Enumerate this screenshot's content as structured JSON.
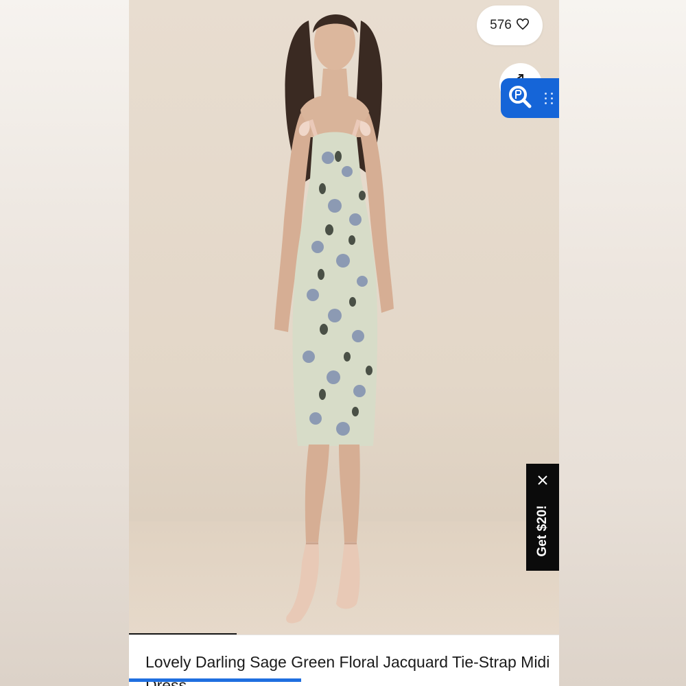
{
  "listing": {
    "likes": "576",
    "title": "Lovely Darling Sage Green Floral Jacquard Tie-Strap Midi Dress"
  },
  "promo": {
    "label": "Get $20!"
  },
  "icons": {
    "like": "heart-icon",
    "share": "share-icon",
    "search": "search-widget-icon",
    "close": "close-icon"
  },
  "colors": {
    "accent_blue": "#1565d8",
    "progress_blue": "#1f6fe0",
    "promo_bg": "#0b0b0b",
    "photo_bg": "#e3d7c8",
    "dress": "#d7dcc8"
  }
}
